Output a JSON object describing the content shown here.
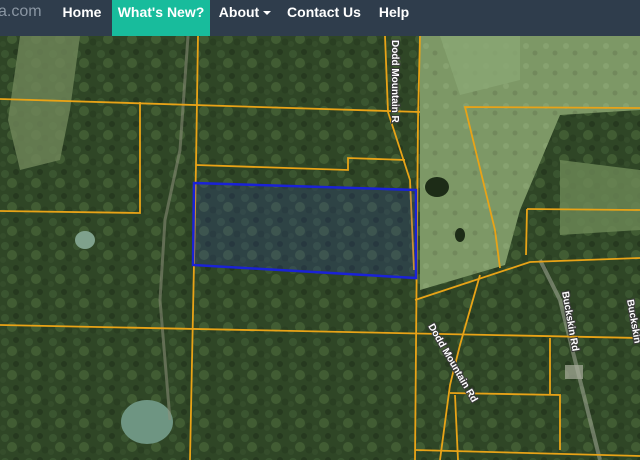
{
  "nav": {
    "brand": "a.com",
    "items": [
      {
        "label": "Home"
      },
      {
        "label": "What's New?",
        "active": true
      },
      {
        "label": "About",
        "has_dropdown": true
      },
      {
        "label": "Contact Us"
      },
      {
        "label": "Help"
      }
    ],
    "colors": {
      "bar": "#2f3d4c",
      "active": "#18bc9c",
      "text": "#ffffff"
    }
  },
  "map": {
    "view": "satellite",
    "parcel_line_color": "#e8a317",
    "selected_parcel_color": "#1a22d6",
    "road_labels": {
      "dodd_north": "Dodd Mountain R",
      "dodd_south": "Dodd Mountain Rd",
      "buckskin": "Buckskin Rd",
      "partial_right": "Buckskin"
    }
  }
}
